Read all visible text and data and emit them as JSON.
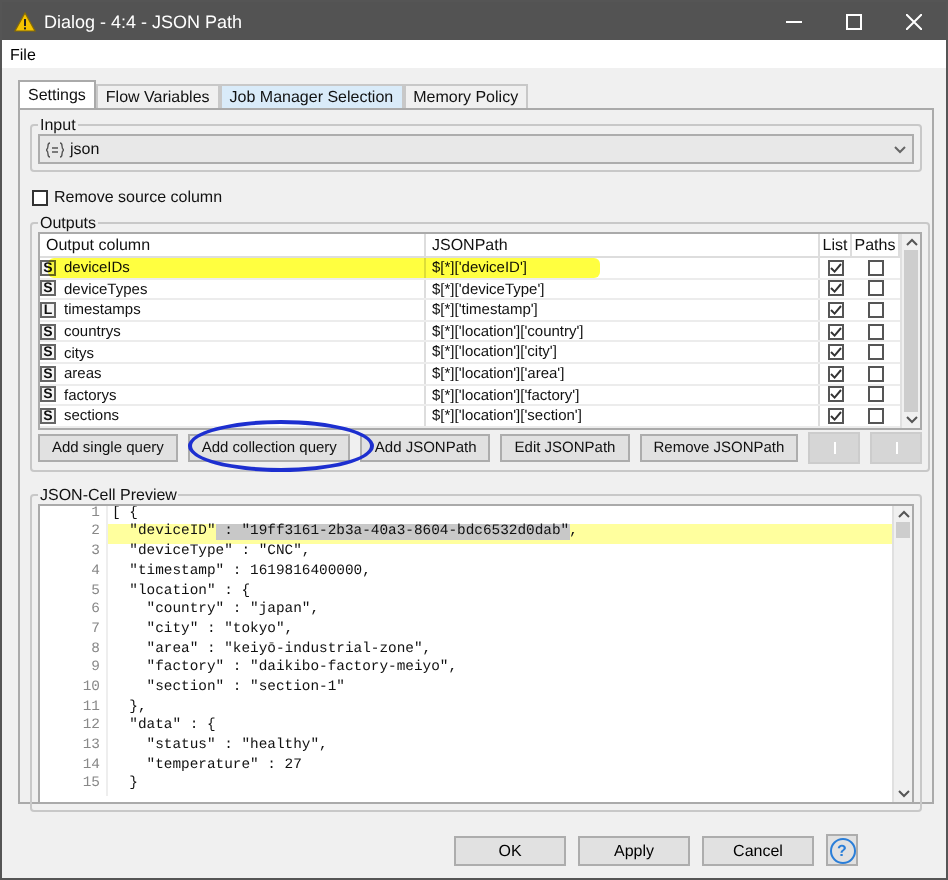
{
  "window": {
    "title": "Dialog - 4:4 - JSON Path"
  },
  "menu": [
    "File"
  ],
  "tabs": [
    {
      "label": "Settings",
      "selected": true
    },
    {
      "label": "Flow Variables",
      "selected": false
    },
    {
      "label": "Job Manager Selection",
      "selected": false
    },
    {
      "label": "Memory Policy",
      "selected": false
    }
  ],
  "input": {
    "legend": "Input",
    "value": "json"
  },
  "remove_source": {
    "label": "Remove source column",
    "checked": false
  },
  "outputs": {
    "legend": "Outputs",
    "columns": [
      "Output column",
      "JSONPath",
      "List",
      "Paths"
    ],
    "rows": [
      {
        "type": "S",
        "name": "deviceIDs",
        "path": "$[*]['deviceID']",
        "list": true,
        "paths": false
      },
      {
        "type": "S",
        "name": "deviceTypes",
        "path": "$[*]['deviceType']",
        "list": true,
        "paths": false
      },
      {
        "type": "L",
        "name": "timestamps",
        "path": "$[*]['timestamp']",
        "list": true,
        "paths": false
      },
      {
        "type": "S",
        "name": "countrys",
        "path": "$[*]['location']['country']",
        "list": true,
        "paths": false
      },
      {
        "type": "S",
        "name": "citys",
        "path": "$[*]['location']['city']",
        "list": true,
        "paths": false
      },
      {
        "type": "S",
        "name": "areas",
        "path": "$[*]['location']['area']",
        "list": true,
        "paths": false
      },
      {
        "type": "S",
        "name": "factorys",
        "path": "$[*]['location']['factory']",
        "list": true,
        "paths": false
      },
      {
        "type": "S",
        "name": "sections",
        "path": "$[*]['location']['section']",
        "list": true,
        "paths": false
      }
    ],
    "buttons": [
      {
        "label": "Add single query",
        "disabled": false
      },
      {
        "label": "Add collection query",
        "disabled": false
      },
      {
        "label": "Add JSONPath",
        "disabled": false
      },
      {
        "label": "Edit JSONPath",
        "disabled": false
      },
      {
        "label": "Remove JSONPath",
        "disabled": false
      }
    ]
  },
  "preview": {
    "legend": "JSON-Cell Preview",
    "lines": [
      {
        "number": "1",
        "current": false,
        "text": "[ {"
      },
      {
        "number": "2",
        "current": true,
        "segments": [
          {
            "text": "  \"deviceID\"",
            "selected": false
          },
          {
            "text": " : \"19ff3161-2b3a-40a3-8604-bdc6532d0dab\"",
            "selected": true
          },
          {
            "text": ",",
            "selected": false
          }
        ]
      },
      {
        "number": "3",
        "current": false,
        "text": "  \"deviceType\" : \"CNC\","
      },
      {
        "number": "4",
        "current": false,
        "text": "  \"timestamp\" : 1619816400000,"
      },
      {
        "number": "5",
        "current": false,
        "text": "  \"location\" : {"
      },
      {
        "number": "6",
        "current": false,
        "text": "    \"country\" : \"japan\","
      },
      {
        "number": "7",
        "current": false,
        "text": "    \"city\" : \"tokyo\","
      },
      {
        "number": "8",
        "current": false,
        "text": "    \"area\" : \"keiyō-industrial-zone\","
      },
      {
        "number": "9",
        "current": false,
        "text": "    \"factory\" : \"daikibo-factory-meiyo\","
      },
      {
        "number": "10",
        "current": false,
        "text": "    \"section\" : \"section-1\""
      },
      {
        "number": "11",
        "current": false,
        "text": "  },"
      },
      {
        "number": "12",
        "current": false,
        "text": "  \"data\" : {"
      },
      {
        "number": "13",
        "current": false,
        "text": "    \"status\" : \"healthy\","
      },
      {
        "number": "14",
        "current": false,
        "text": "    \"temperature\" : 27"
      },
      {
        "number": "15",
        "current": false,
        "text": "  }"
      }
    ]
  },
  "footer": {
    "buttons": [
      "OK",
      "Apply",
      "Cancel"
    ],
    "help": "?"
  }
}
